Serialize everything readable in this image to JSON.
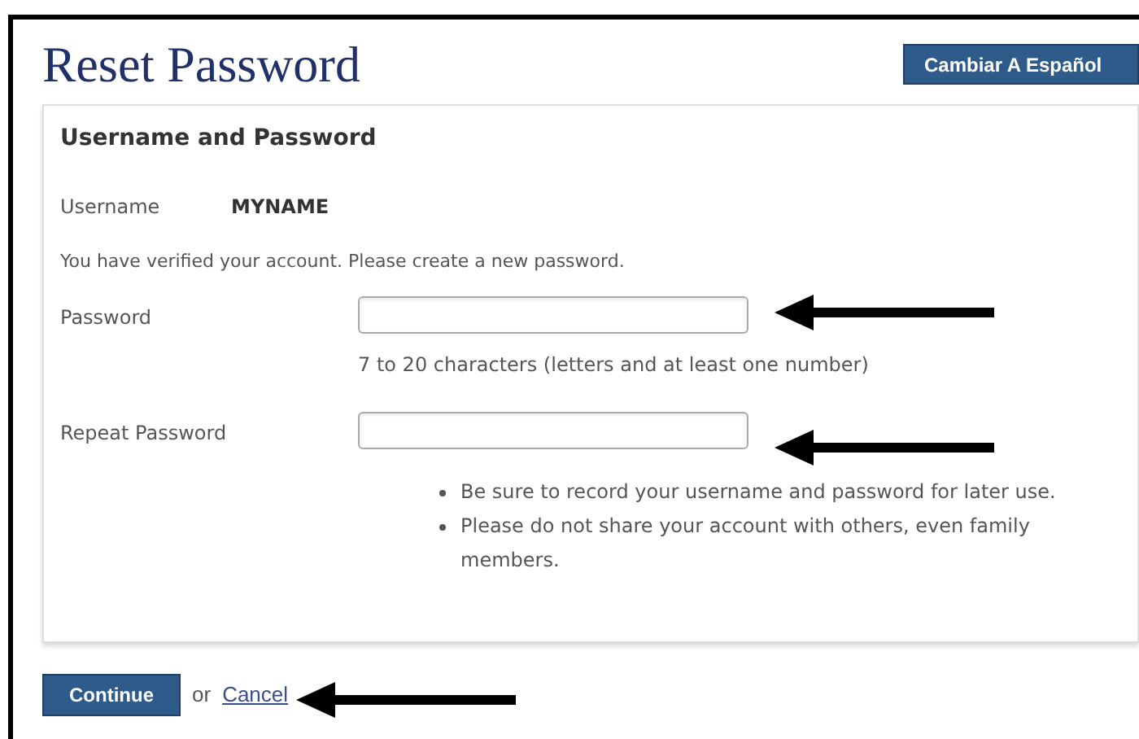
{
  "title": "Reset Password",
  "language_button": "Cambiar A Español",
  "panel": {
    "heading": "Username and Password",
    "username_label": "Username",
    "username_value": "MYNAME",
    "intro": "You have verified your account. Please create a new password.",
    "fields": [
      {
        "label": "Password",
        "hint": "7 to 20 characters (letters and at least one number)"
      },
      {
        "label": "Repeat Password"
      }
    ],
    "notes": [
      "Be sure to record your username and password for later use.",
      "Please do not share your account with others, even family members."
    ]
  },
  "continue_button": "Continue",
  "or_text": "or",
  "cancel_link": "Cancel",
  "annotations": [
    {
      "kind": "arrow"
    },
    {
      "kind": "arrow"
    },
    {
      "kind": "arrow"
    }
  ]
}
